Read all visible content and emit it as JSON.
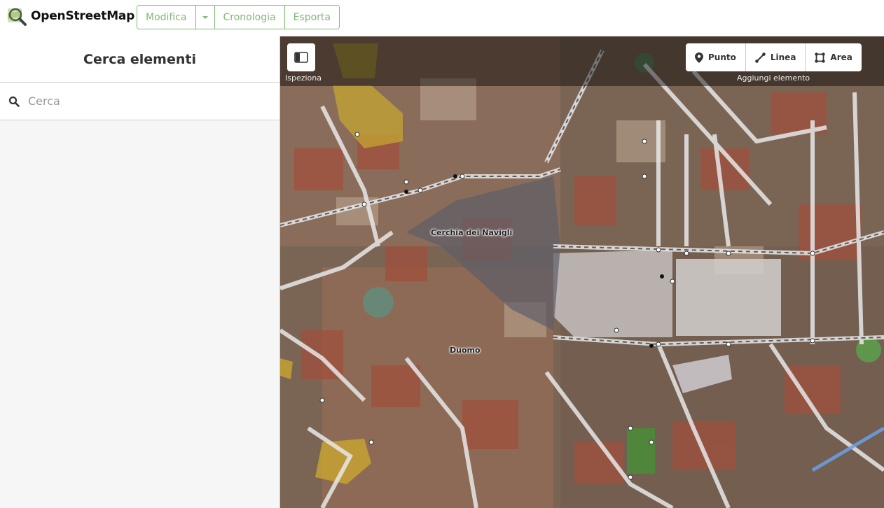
{
  "app": {
    "name": "OpenStreetMap"
  },
  "toolbar": {
    "edit_label": "Modifica",
    "history_label": "Cronologia",
    "export_label": "Esporta"
  },
  "sidebar": {
    "title": "Cerca elementi",
    "search_placeholder": "Cerca"
  },
  "map": {
    "inspect_label": "Ispeziona",
    "add_label": "Aggiungi elemento",
    "tools": {
      "point": "Punto",
      "line": "Linea",
      "area": "Area"
    },
    "labels": {
      "navigli": "Cerchia dei Navigli",
      "duomo": "Duomo"
    }
  },
  "colors": {
    "accent": "#7ebc6f"
  }
}
